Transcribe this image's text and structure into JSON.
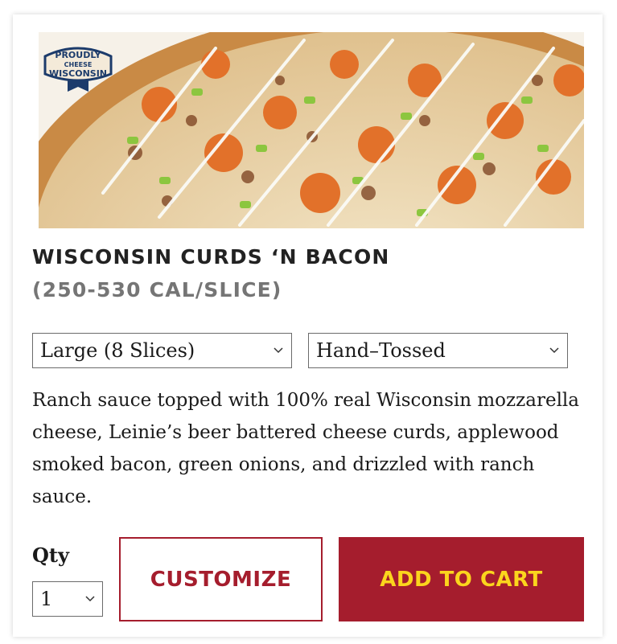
{
  "product": {
    "title": "WISCONSIN CURDS ‘N BACON",
    "calories": "(250-530 CAL/SLICE)",
    "description": "Ranch sauce topped with 100% real Wisconsin mozzarella cheese, Leinie’s beer battered cheese curds, applewood smoked bacon, green onions, and drizzled with ranch sauce.",
    "image_icon": "pizza-photo",
    "badge": {
      "line1": "PROUDLY",
      "line2": "CHEESE",
      "line3": "WISCONSIN"
    }
  },
  "options": {
    "size_selected": "Large (8 Slices)",
    "crust_selected": "Hand–Tossed"
  },
  "quantity": {
    "label": "Qty",
    "value": "1"
  },
  "actions": {
    "customize_label": "CUSTOMIZE",
    "add_to_cart_label": "ADD TO CART"
  },
  "colors": {
    "brand_red": "#a51d2d",
    "brand_yellow": "#fbd51d",
    "calorie_gray": "#757575"
  }
}
